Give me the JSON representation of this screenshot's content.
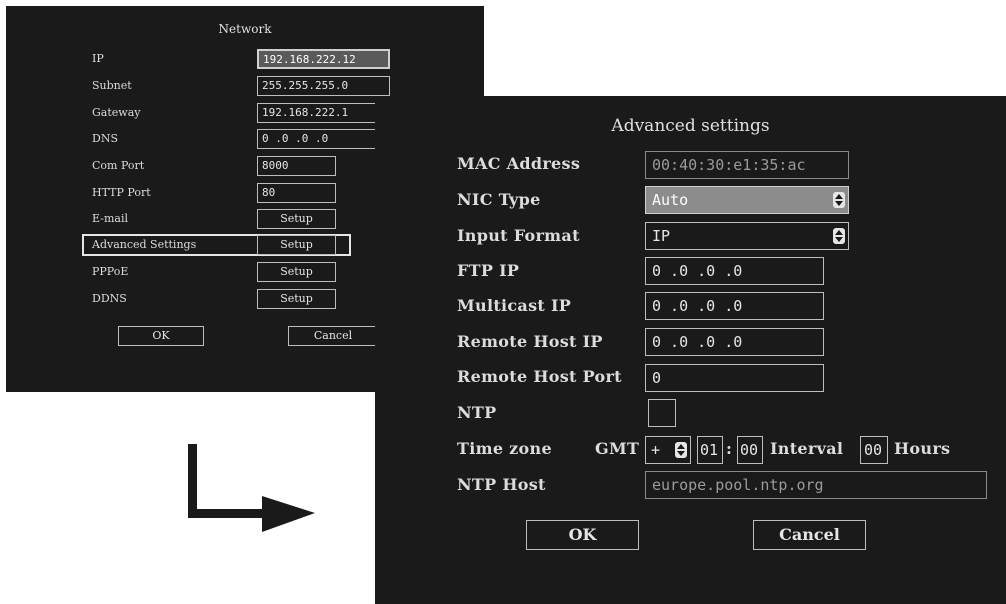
{
  "network": {
    "title": "Network",
    "rows": [
      {
        "label": "IP",
        "value": "192.168.222.12"
      },
      {
        "label": "Subnet",
        "value": "255.255.255.0"
      },
      {
        "label": "Gateway",
        "value": "192.168.222.1"
      },
      {
        "label": "DNS",
        "value": "0  .0  .0  .0"
      },
      {
        "label": "Com Port",
        "value": "8000"
      },
      {
        "label": "HTTP Port",
        "value": "80"
      },
      {
        "label": "E-mail",
        "button": "Setup"
      },
      {
        "label": "Advanced Settings",
        "button": "Setup"
      },
      {
        "label": "PPPoE",
        "button": "Setup"
      },
      {
        "label": "DDNS",
        "button": "Setup"
      }
    ],
    "ok_label": "OK",
    "cancel_label": "Cancel"
  },
  "advanced": {
    "title": "Advanced settings",
    "mac_label": "MAC Address",
    "mac_value": "00:40:30:e1:35:ac",
    "nic_label": "NIC Type",
    "nic_value": "Auto",
    "input_format_label": "Input Format",
    "input_format_value": "IP",
    "ftp_ip_label": "FTP IP",
    "ftp_ip_value": "0  .0  .0  .0",
    "multicast_ip_label": "Multicast IP",
    "multicast_ip_value": "0  .0  .0  .0",
    "remote_host_ip_label": "Remote Host IP",
    "remote_host_ip_value": "0  .0  .0  .0",
    "remote_host_port_label": "Remote Host Port",
    "remote_host_port_value": "0",
    "ntp_label": "NTP",
    "ntp_checked": false,
    "timezone_label": "Time zone",
    "gmt_label": "GMT",
    "tz_sign": "+",
    "tz_hours": "01",
    "tz_sep": ":",
    "tz_minutes": "00",
    "interval_label": "Interval",
    "interval_value": "00",
    "hours_label": "Hours",
    "ntp_host_label": "NTP Host",
    "ntp_host_value": "europe.pool.ntp.org",
    "ok_label": "OK",
    "cancel_label": "Cancel"
  },
  "colors": {
    "panel_bg": "#1a1a1a",
    "text": "#e6e6e6",
    "highlight": "#8c8c8c",
    "arrow": "#1a1a1a"
  },
  "icons": {
    "arrow": "arrow-down-right-icon",
    "spinner": "up-down-spinner-icon"
  }
}
